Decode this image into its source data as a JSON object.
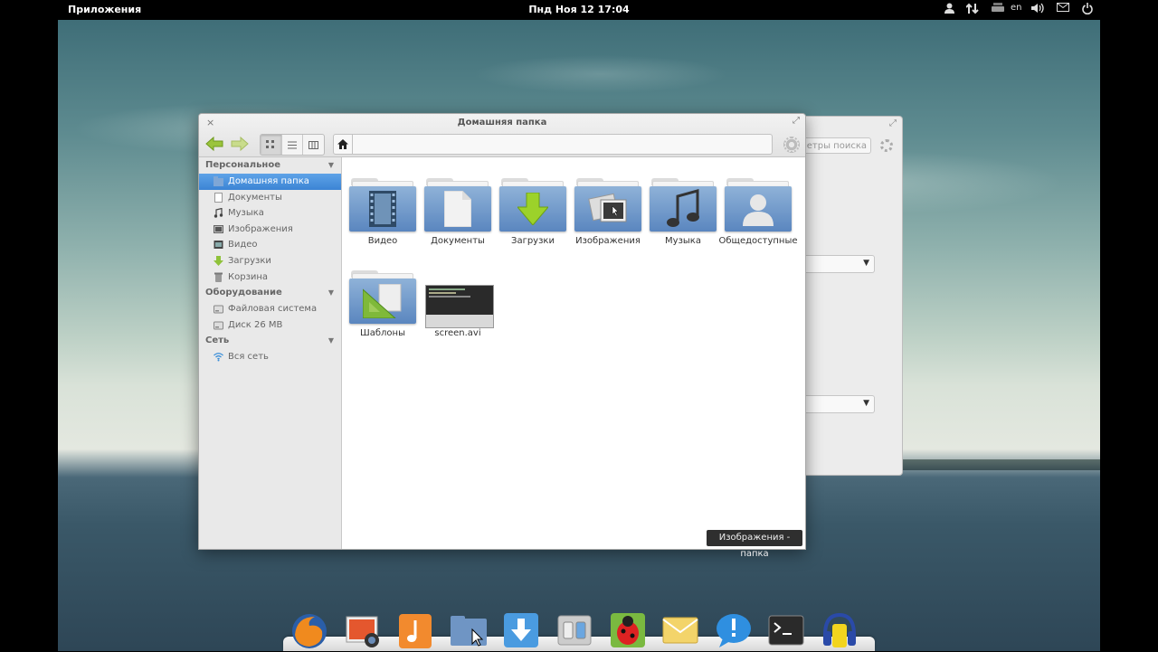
{
  "panel": {
    "apps_label": "Приложения",
    "clock": "Пнд Ноя 12 17:04",
    "lang": "en"
  },
  "window": {
    "title": "Домашняя папка",
    "view_modes": [
      "icons",
      "list",
      "columns"
    ],
    "active_view": "icons"
  },
  "sidebar": {
    "sections": [
      {
        "title": "Персональное",
        "items": [
          {
            "label": "Домашняя папка",
            "icon": "home-folder-icon",
            "selected": true
          },
          {
            "label": "Документы",
            "icon": "document-icon"
          },
          {
            "label": "Музыка",
            "icon": "music-icon"
          },
          {
            "label": "Изображения",
            "icon": "image-icon"
          },
          {
            "label": "Видео",
            "icon": "video-icon"
          },
          {
            "label": "Загрузки",
            "icon": "download-icon"
          },
          {
            "label": "Корзина",
            "icon": "trash-icon"
          }
        ]
      },
      {
        "title": "Оборудование",
        "items": [
          {
            "label": "Файловая система",
            "icon": "drive-icon"
          },
          {
            "label": "Диск 26 MB",
            "icon": "drive-icon"
          }
        ]
      },
      {
        "title": "Сеть",
        "items": [
          {
            "label": "Вся сеть",
            "icon": "wifi-icon"
          }
        ]
      }
    ]
  },
  "files": [
    {
      "name": "Видео",
      "icon": "video-folder-icon"
    },
    {
      "name": "Документы",
      "icon": "documents-folder-icon"
    },
    {
      "name": "Загрузки",
      "icon": "downloads-folder-icon"
    },
    {
      "name": "Изображения",
      "icon": "pictures-folder-icon"
    },
    {
      "name": "Музыка",
      "icon": "music-folder-icon"
    },
    {
      "name": "Общедоступные",
      "icon": "public-folder-icon"
    },
    {
      "name": "Шаблоны",
      "icon": "templates-folder-icon"
    },
    {
      "name": "screen.avi",
      "icon": "video-thumbnail"
    }
  ],
  "tooltip": "Изображения - папка",
  "background_window": {
    "search_placeholder": "етры поиска"
  },
  "dock": [
    "firefox-icon",
    "photos-icon",
    "music-player-icon",
    "files-icon",
    "downloads-icon",
    "settings-icon",
    "bug-tracker-icon",
    "mail-icon",
    "messaging-icon",
    "terminal-icon",
    "audio-icon"
  ]
}
